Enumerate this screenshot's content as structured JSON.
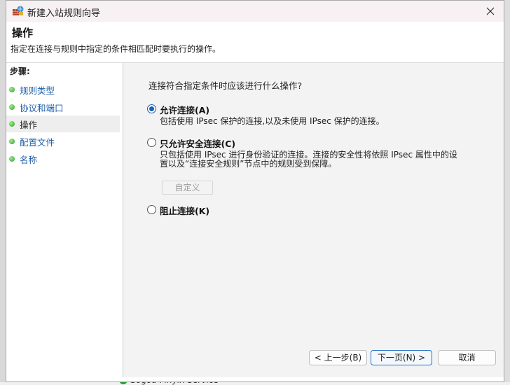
{
  "window": {
    "title": "新建入站规则向导"
  },
  "header": {
    "title": "操作",
    "description": "指定在连接与规则中指定的条件相匹配时要执行的操作。"
  },
  "sidebar": {
    "heading": "步骤:",
    "steps": [
      {
        "label": "规则类型"
      },
      {
        "label": "协议和端口"
      },
      {
        "label": "操作"
      },
      {
        "label": "配置文件"
      },
      {
        "label": "名称"
      }
    ]
  },
  "content": {
    "question": "连接符合指定条件时应该进行什么操作?",
    "options": [
      {
        "label": "允许连接(A)",
        "description": "包括使用 IPsec 保护的连接,以及未使用 IPsec 保护的连接。",
        "selected": true
      },
      {
        "label": "只允许安全连接(C)",
        "description_line1": "只包括使用 IPsec 进行身份验证的连接。连接的安全性将依照 IPsec 属性中的设",
        "description_line2": "置以及“连接安全规则”节点中的规则受到保障。",
        "selected": false
      },
      {
        "label": "阻止连接(K)",
        "selected": false
      }
    ],
    "customize_label": "自定义"
  },
  "footer": {
    "back_label": "< 上一步(B)",
    "next_label": "下一页(N) >",
    "cancel_label": "取消"
  },
  "background": {
    "service_text": "Sogou Pinyin Service"
  },
  "colors": {
    "accent": "#1b5fb0",
    "link": "#1f5fa8",
    "step_dot": "#2e9b2a"
  }
}
